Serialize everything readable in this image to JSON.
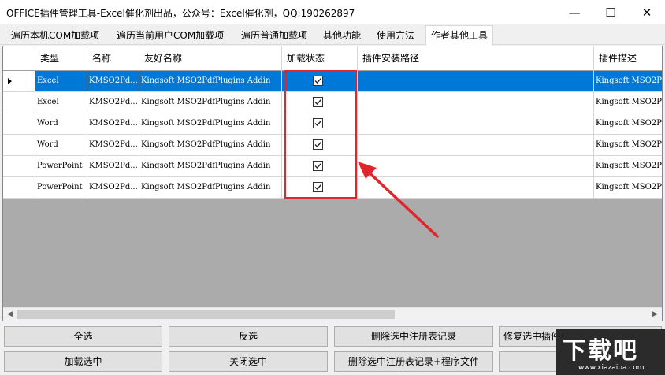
{
  "window": {
    "title": "OFFICE插件管理工具-Excel催化剂出品，公众号：Excel催化剂，QQ:190262897",
    "minimize": "—",
    "maximize": "☐",
    "close": "✕"
  },
  "tabs": [
    {
      "label": "遍历本机COM加载项"
    },
    {
      "label": "遍历当前用户COM加载项"
    },
    {
      "label": "遍历普通加载项"
    },
    {
      "label": "其他功能"
    },
    {
      "label": "使用方法"
    },
    {
      "label": "作者其他工具"
    }
  ],
  "grid": {
    "columns": [
      "类型",
      "名称",
      "友好名称",
      "加载状态",
      "插件安装路径",
      "插件描述"
    ],
    "rows": [
      {
        "type": "Excel",
        "name": "KMSO2Pd...",
        "friendly": "Kingsoft MSO2PdfPlugins Addin",
        "loaded": true,
        "path": "",
        "desc": "Kingsoft MSO2P"
      },
      {
        "type": "Excel",
        "name": "KMSO2Pd...",
        "friendly": "Kingsoft MSO2PdfPlugins Addin",
        "loaded": true,
        "path": "",
        "desc": "Kingsoft MSO2P"
      },
      {
        "type": "Word",
        "name": "KMSO2Pd...",
        "friendly": "Kingsoft MSO2PdfPlugins Addin",
        "loaded": true,
        "path": "",
        "desc": "Kingsoft MSO2P"
      },
      {
        "type": "Word",
        "name": "KMSO2Pd...",
        "friendly": "Kingsoft MSO2PdfPlugins Addin",
        "loaded": true,
        "path": "",
        "desc": "Kingsoft MSO2P"
      },
      {
        "type": "PowerPoint",
        "name": "KMSO2Pd...",
        "friendly": "Kingsoft MSO2PdfPlugins Addin",
        "loaded": true,
        "path": "",
        "desc": "Kingsoft MSO2P"
      },
      {
        "type": "PowerPoint",
        "name": "KMSO2Pd...",
        "friendly": "Kingsoft MSO2PdfPlugins Addin",
        "loaded": true,
        "path": "",
        "desc": "Kingsoft MSO2P"
      }
    ],
    "selected_row": 0
  },
  "buttons": {
    "select_all": "全选",
    "invert": "反选",
    "delete_reg": "删除选中注册表记录",
    "repair": "修复选中插件",
    "load_selected": "加载选中",
    "close_selected": "关闭选中",
    "delete_reg_files": "删除选中注册表记录+程序文件"
  },
  "watermark": {
    "text": "下载吧",
    "url": "www.xiazaiba.com"
  },
  "colors": {
    "selection": "#0078d7",
    "highlight": "#e0252b"
  }
}
